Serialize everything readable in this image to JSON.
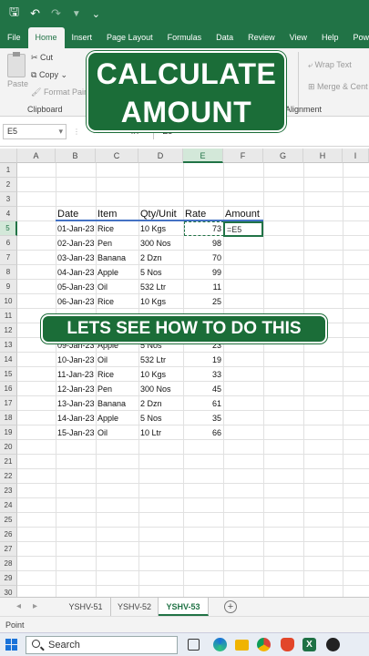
{
  "qat": {
    "save": "🖫",
    "undo": "↶",
    "redo": "↷",
    "filter": "▼",
    "more": "⌄"
  },
  "tabs": [
    "File",
    "Home",
    "Insert",
    "Page Layout",
    "Formulas",
    "Data",
    "Review",
    "View",
    "Help",
    "Pow"
  ],
  "ribbon": {
    "paste": "Paste",
    "cut": "Cut",
    "copy": "Copy",
    "format_painter": "Format Painter",
    "clipboard": "Clipboard",
    "wrap_text": "Wrap Text",
    "merge_center": "Merge & Cent",
    "alignment": "Alignment"
  },
  "overlay_title": "CALCULATE AMOUNT",
  "overlay_banner": "LETS SEE HOW TO DO THIS",
  "formula_bar": {
    "name_box": "E5",
    "cancel": "✕",
    "enter": "✓",
    "fx": "fx",
    "formula": "=E5"
  },
  "columns": [
    "A",
    "B",
    "C",
    "D",
    "E",
    "F",
    "G",
    "H",
    "I"
  ],
  "rows": [
    1,
    2,
    3,
    4,
    5,
    6,
    7,
    8,
    9,
    10,
    11,
    12,
    13,
    14,
    15,
    16,
    17,
    18,
    19,
    20,
    21,
    22,
    23,
    24,
    25,
    26,
    27,
    28,
    29,
    30
  ],
  "table": {
    "headers": {
      "date": "Date",
      "item": "Item",
      "qty": "Qty/Unit",
      "rate": "Rate",
      "amount": "Amount"
    },
    "active_cell_text": "=E5",
    "rows": [
      {
        "row": 5,
        "date": "01-Jan-23",
        "item": "Rice",
        "qty": "10 Kgs",
        "rate": "73"
      },
      {
        "row": 6,
        "date": "02-Jan-23",
        "item": "Pen",
        "qty": "300 Nos",
        "rate": "98"
      },
      {
        "row": 7,
        "date": "03-Jan-23",
        "item": "Banana",
        "qty": "2 Dzn",
        "rate": "70"
      },
      {
        "row": 8,
        "date": "04-Jan-23",
        "item": "Apple",
        "qty": "5 Nos",
        "rate": "99"
      },
      {
        "row": 9,
        "date": "05-Jan-23",
        "item": "Oil",
        "qty": "532 Ltr",
        "rate": "11"
      },
      {
        "row": 10,
        "date": "06-Jan-23",
        "item": "Rice",
        "qty": "10 Kgs",
        "rate": "25"
      },
      {
        "row": 13,
        "date": "09-Jan-23",
        "item": "Apple",
        "qty": "5 Nos",
        "rate": "23"
      },
      {
        "row": 14,
        "date": "10-Jan-23",
        "item": "Oil",
        "qty": "532 Ltr",
        "rate": "19"
      },
      {
        "row": 15,
        "date": "11-Jan-23",
        "item": "Rice",
        "qty": "10 Kgs",
        "rate": "33"
      },
      {
        "row": 16,
        "date": "12-Jan-23",
        "item": "Pen",
        "qty": "300 Nos",
        "rate": "45"
      },
      {
        "row": 17,
        "date": "13-Jan-23",
        "item": "Banana",
        "qty": "2 Dzn",
        "rate": "61"
      },
      {
        "row": 18,
        "date": "14-Jan-23",
        "item": "Apple",
        "qty": "5 Nos",
        "rate": "35"
      },
      {
        "row": 19,
        "date": "15-Jan-23",
        "item": "Oil",
        "qty": "10 Ltr",
        "rate": "66"
      }
    ]
  },
  "sheets": [
    "YSHV-51",
    "YSHV-52",
    "YSHV-53"
  ],
  "active_sheet": "YSHV-53",
  "status": "Point",
  "taskbar": {
    "search": "Search"
  }
}
